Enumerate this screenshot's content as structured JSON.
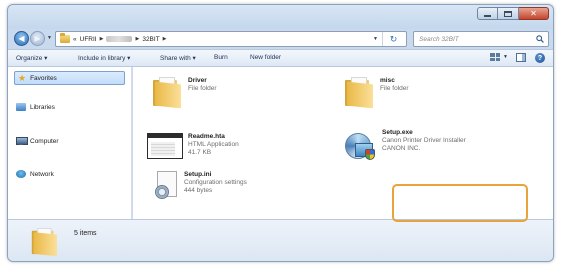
{
  "address": {
    "crumbs": [
      "«",
      "UFRII",
      "32BIT"
    ],
    "search_placeholder": "Search 32BIT"
  },
  "toolbar": {
    "organize": "Organize ▾",
    "include": "Include in library ▾",
    "share": "Share with ▾",
    "burn": "Burn",
    "new_folder": "New folder"
  },
  "navigation": {
    "favorites": "Favorites",
    "libraries": "Libraries",
    "computer": "Computer",
    "network": "Network"
  },
  "files": [
    {
      "name": "Driver",
      "lines": [
        "File folder"
      ]
    },
    {
      "name": "misc",
      "lines": [
        "File folder"
      ]
    },
    {
      "name": "Readme.hta",
      "lines": [
        "HTML Application",
        "41.7 KB"
      ]
    },
    {
      "name": "Setup.exe",
      "lines": [
        "Canon Printer Driver Installer",
        "CANON INC."
      ]
    },
    {
      "name": "Setup.ini",
      "lines": [
        "Configuration settings",
        "444 bytes"
      ]
    }
  ],
  "details": {
    "item_count": "5 items"
  },
  "colors": {
    "window_frame": "#c9daee",
    "highlight": "#e8a33d",
    "close_button": "#c4452b"
  },
  "icons": [
    "back-arrow-icon",
    "forward-arrow-icon",
    "folder-icon",
    "search-icon",
    "refresh-icon",
    "star-icon",
    "library-icon",
    "computer-icon",
    "network-icon",
    "help-icon"
  ]
}
